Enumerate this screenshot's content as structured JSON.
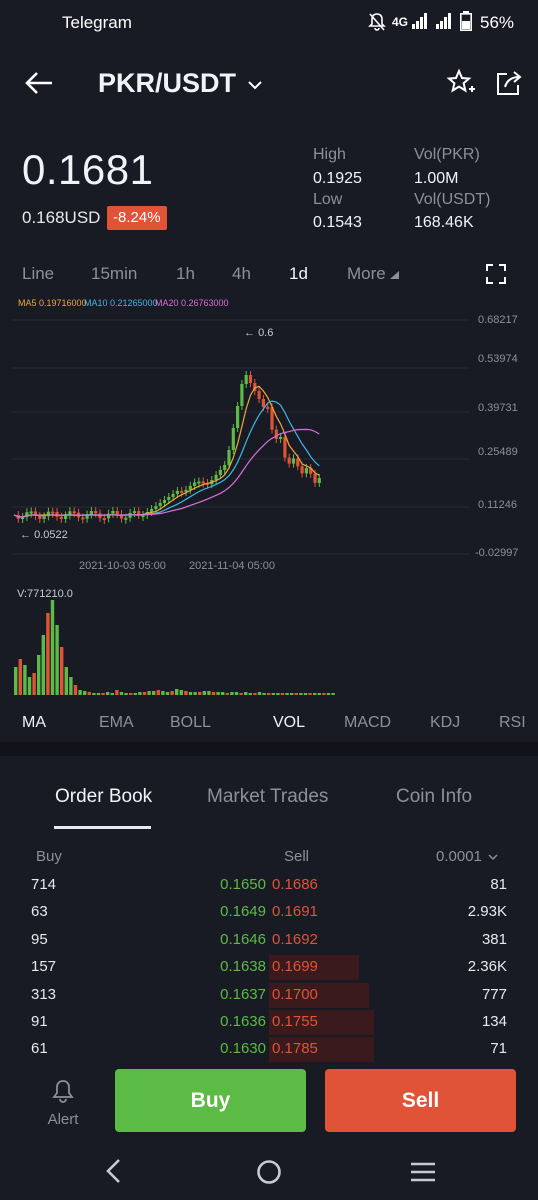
{
  "status_bar": {
    "app": "Telegram",
    "network": "4G",
    "battery": "56%"
  },
  "header": {
    "pair": "PKR/USDT"
  },
  "price": {
    "last": "0.1681",
    "usd": "0.168USD",
    "change": "-8.24%",
    "high_label": "High",
    "high": "0.1925",
    "low_label": "Low",
    "low": "0.1543",
    "vol_base_label": "Vol(PKR)",
    "vol_base": "1.00M",
    "vol_quote_label": "Vol(USDT)",
    "vol_quote": "168.46K"
  },
  "intervals": [
    "Line",
    "15min",
    "1h",
    "4h",
    "1d",
    "More"
  ],
  "active_interval": "1d",
  "ma_legend": {
    "ma5": "MA5 0.19716000",
    "ma10": "MA10 0.21265000",
    "ma20": "MA20 0.26763000"
  },
  "colors": {
    "up": "#5bbb44",
    "down": "#e05336",
    "ma5": "#f0a63a",
    "ma10": "#3fb6e6",
    "ma20": "#d86fd8",
    "bg": "#191b24"
  },
  "chart_data": {
    "type": "candlestick",
    "y_axis_ticks": [
      "0.68217",
      "0.53974",
      "0.39731",
      "0.25489",
      "0.11246",
      "-0.02997"
    ],
    "ylim": [
      -0.02997,
      0.68217
    ],
    "x_tick_labels": [
      "2021-10-03 05:00",
      "2021-11-04 05:00"
    ],
    "max_annotation": "0.6",
    "min_annotation": "0.0522",
    "volume_label": "V:771210.0"
  },
  "indicators": [
    "MA",
    "EMA",
    "BOLL",
    "VOL",
    "MACD",
    "KDJ",
    "RSI"
  ],
  "tabs": [
    "Order Book",
    "Market Trades",
    "Coin Info"
  ],
  "order_book": {
    "buy_label": "Buy",
    "sell_label": "Sell",
    "precision": "0.0001",
    "rows": [
      {
        "buy_qty": "714",
        "buy_price": "0.1650",
        "sell_price": "0.1686",
        "sell_qty": "81"
      },
      {
        "buy_qty": "63",
        "buy_price": "0.1649",
        "sell_price": "0.1691",
        "sell_qty": "2.93K"
      },
      {
        "buy_qty": "95",
        "buy_price": "0.1646",
        "sell_price": "0.1692",
        "sell_qty": "381"
      },
      {
        "buy_qty": "157",
        "buy_price": "0.1638",
        "sell_price": "0.1699",
        "sell_qty": "2.36K"
      },
      {
        "buy_qty": "313",
        "buy_price": "0.1637",
        "sell_price": "0.1700",
        "sell_qty": "777"
      },
      {
        "buy_qty": "91",
        "buy_price": "0.1636",
        "sell_price": "0.1755",
        "sell_qty": "134"
      },
      {
        "buy_qty": "61",
        "buy_price": "0.1630",
        "sell_price": "0.1785",
        "sell_qty": "71"
      }
    ]
  },
  "actions": {
    "alert": "Alert",
    "buy": "Buy",
    "sell": "Sell"
  }
}
